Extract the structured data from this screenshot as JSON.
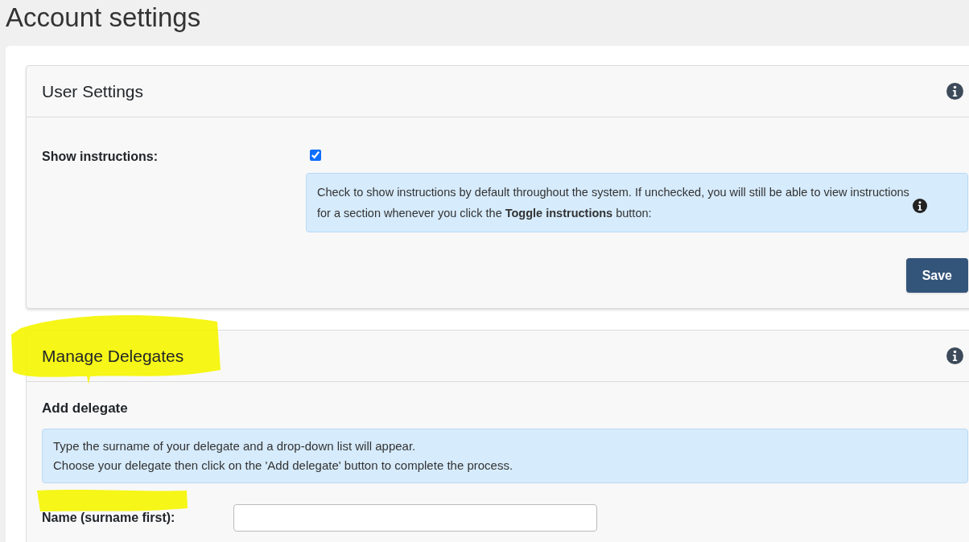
{
  "page_title": "Account settings",
  "user_settings": {
    "title": "User Settings",
    "show_instructions": {
      "label": "Show instructions:",
      "checked": true
    },
    "help_text": "Check to show instructions by default throughout the system. If unchecked, you will still be able to view instructions for a section whenever you click the **Toggle instructions** button:",
    "save_button": "Save"
  },
  "manage_delegates": {
    "title": "Manage Delegates",
    "subtitle": "Add delegate",
    "help_lines": [
      "Type the surname of your delegate and a drop-down list will appear.",
      "Choose your delegate then click on the 'Add delegate' button to complete the process."
    ],
    "name_field": {
      "label": "Name (surname first):"
    }
  }
}
